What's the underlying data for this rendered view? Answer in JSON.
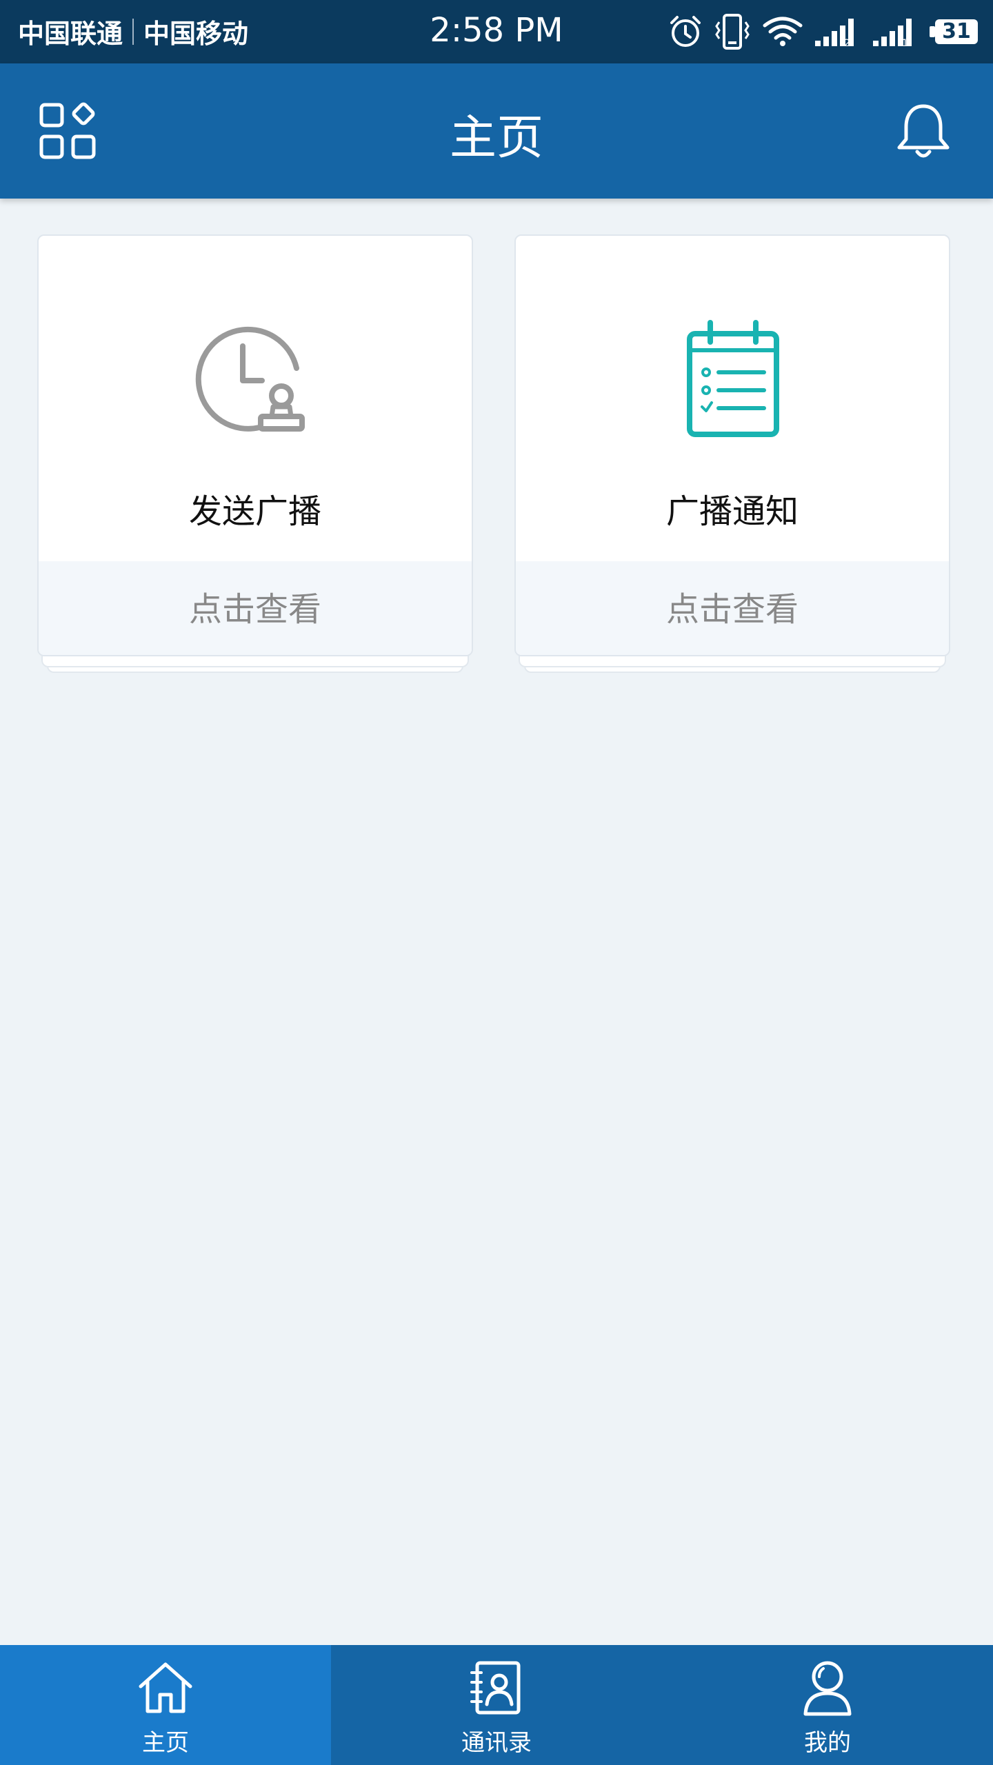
{
  "status_bar": {
    "carrier_1": "中国联通",
    "carrier_2": "中国移动",
    "time": "2:58 PM",
    "battery_level": "31",
    "icons": [
      "alarm-icon",
      "vibrate-icon",
      "wifi-icon",
      "signal-sim2-icon",
      "signal-sim1-icon",
      "battery-icon"
    ]
  },
  "header": {
    "title": "主页",
    "left_icon": "apps-icon",
    "right_icon": "bell-icon",
    "background": "#1565a5"
  },
  "cards": [
    {
      "title": "发送广播",
      "footer": "点击查看",
      "icon": "clock-user-icon",
      "icon_color": "#9a9a9a"
    },
    {
      "title": "广播通知",
      "footer": "点击查看",
      "icon": "clipboard-checklist-icon",
      "icon_color": "#19b3b1"
    }
  ],
  "tabbar": {
    "tabs": [
      {
        "label": "主页",
        "icon": "home-icon",
        "active": true
      },
      {
        "label": "通讯录",
        "icon": "contacts-icon",
        "active": false
      },
      {
        "label": "我的",
        "icon": "profile-icon",
        "active": false
      }
    ],
    "active_color": "#1a7bcb",
    "background": "#1565a5"
  }
}
